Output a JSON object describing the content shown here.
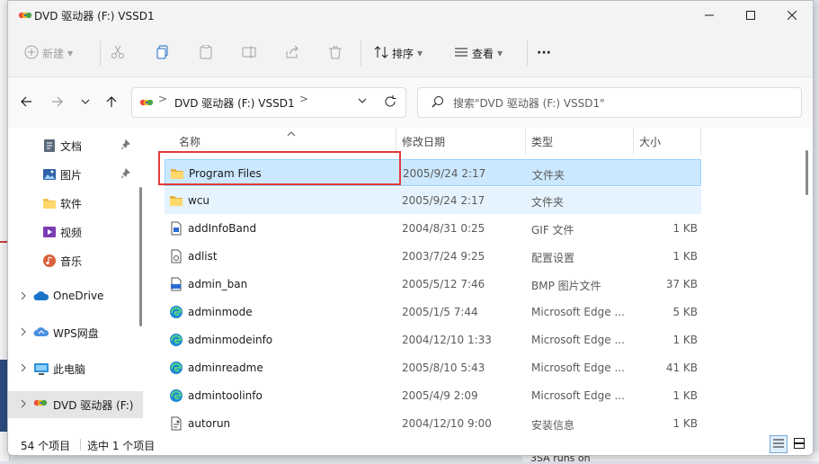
{
  "window": {
    "title": "DVD 驱动器 (F:) VSSD1"
  },
  "toolbar": {
    "new_label": "新建",
    "sort_label": "排序",
    "view_label": "查看",
    "more_label": "···"
  },
  "address": {
    "crumb": "DVD 驱动器 (F:) VSSD1",
    "separator": ">"
  },
  "search": {
    "placeholder": "搜索\"DVD 驱动器 (F:) VSSD1\""
  },
  "sidebar": {
    "items": [
      {
        "label": "文档",
        "icon": "documents-icon",
        "pinned": true
      },
      {
        "label": "图片",
        "icon": "pictures-icon",
        "pinned": true
      },
      {
        "label": "软件",
        "icon": "folder-icon",
        "pinned": false
      },
      {
        "label": "视频",
        "icon": "videos-icon",
        "pinned": false
      },
      {
        "label": "音乐",
        "icon": "music-icon",
        "pinned": false
      },
      {
        "label": "OneDrive",
        "icon": "cloud-icon",
        "expandable": true
      },
      {
        "label": "WPS网盘",
        "icon": "cloud-icon",
        "expandable": true
      },
      {
        "label": "此电脑",
        "icon": "computer-icon",
        "expandable": true
      },
      {
        "label": "DVD 驱动器 (F:)",
        "icon": "dvd-drive-icon",
        "expandable": true,
        "selected": true
      }
    ]
  },
  "columns": {
    "name": "名称",
    "modified": "修改日期",
    "type": "类型",
    "size": "大小"
  },
  "files": [
    {
      "name": "Program Files",
      "modified": "2005/9/24 2:17",
      "type": "文件夹",
      "size": "",
      "icon": "folder-icon",
      "selected": true
    },
    {
      "name": "wcu",
      "modified": "2005/9/24 2:17",
      "type": "文件夹",
      "size": "",
      "icon": "folder-icon",
      "hover": true
    },
    {
      "name": "addInfoBand",
      "modified": "2004/8/31 0:25",
      "type": "GIF 文件",
      "size": "1 KB",
      "icon": "image-file-icon"
    },
    {
      "name": "adlist",
      "modified": "2003/7/24 9:25",
      "type": "配置设置",
      "size": "1 KB",
      "icon": "settings-file-icon"
    },
    {
      "name": "admin_ban",
      "modified": "2005/5/12 7:46",
      "type": "BMP 图片文件",
      "size": "37 KB",
      "icon": "bmp-file-icon"
    },
    {
      "name": "adminmode",
      "modified": "2005/1/5 7:44",
      "type": "Microsoft Edge ...",
      "size": "5 KB",
      "icon": "edge-icon"
    },
    {
      "name": "adminmodeinfo",
      "modified": "2004/12/10 1:33",
      "type": "Microsoft Edge ...",
      "size": "1 KB",
      "icon": "edge-icon"
    },
    {
      "name": "adminreadme",
      "modified": "2005/8/10 5:43",
      "type": "Microsoft Edge ...",
      "size": "41 KB",
      "icon": "edge-icon"
    },
    {
      "name": "admintoolinfo",
      "modified": "2005/4/9 2:09",
      "type": "Microsoft Edge ...",
      "size": "1 KB",
      "icon": "edge-icon"
    },
    {
      "name": "autorun",
      "modified": "2004/12/10 9:00",
      "type": "安装信息",
      "size": "1 KB",
      "icon": "setup-info-icon"
    }
  ],
  "status": {
    "count": "54 个项目",
    "selection": "选中 1 个项目"
  },
  "background": {
    "text": "3SA runs on"
  },
  "colors": {
    "accent": "#0067c0",
    "selection": "#cce8ff",
    "highlight_box": "#e23b3b"
  }
}
